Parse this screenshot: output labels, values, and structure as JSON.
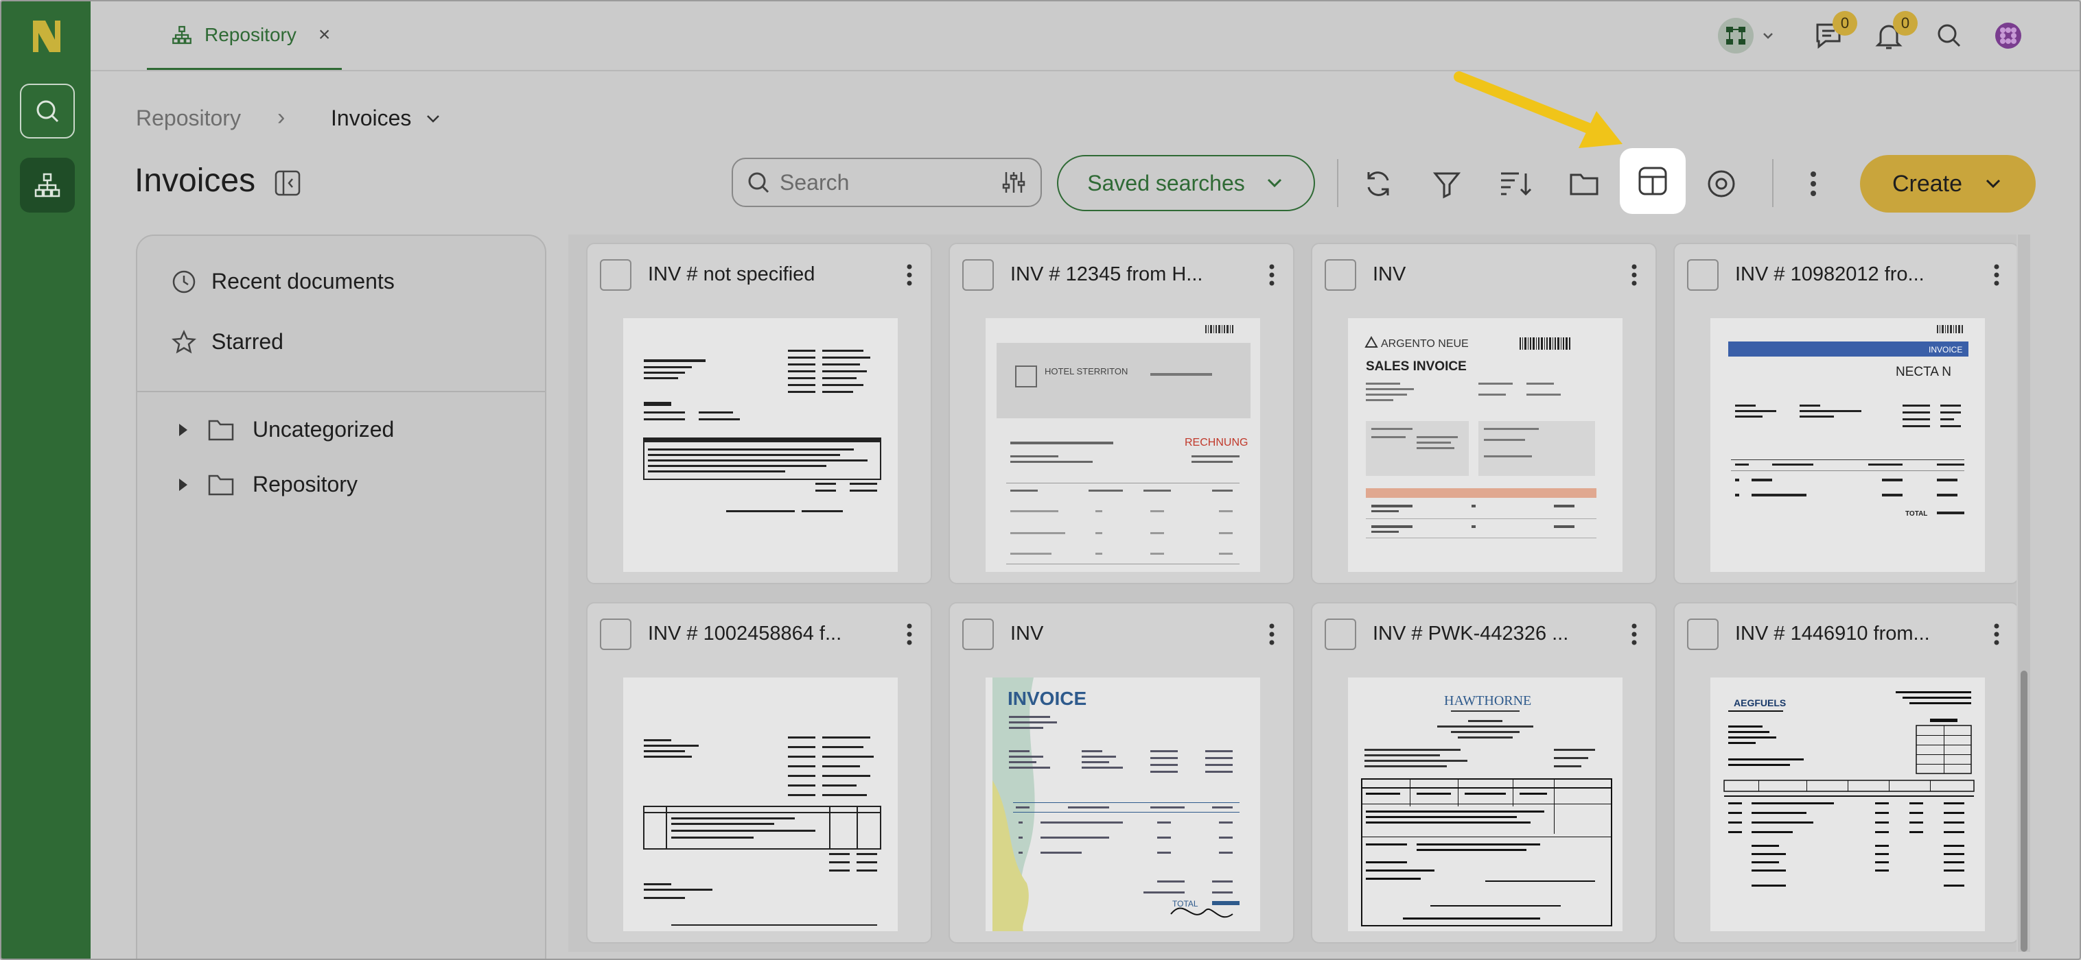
{
  "app": {
    "tab_label": "Repository",
    "tab_close": "×"
  },
  "top_badges": {
    "messages": "0",
    "notifications": "0"
  },
  "breadcrumb": {
    "root": "Repository",
    "separator": "›",
    "current": "Invoices"
  },
  "page": {
    "title": "Invoices"
  },
  "search": {
    "placeholder": "Search"
  },
  "toolbar": {
    "saved_searches": "Saved searches",
    "create": "Create"
  },
  "sidebar": {
    "nav": [
      {
        "label": "Recent documents",
        "icon": "clock-icon"
      },
      {
        "label": "Starred",
        "icon": "star-icon"
      }
    ],
    "tree": [
      {
        "label": "Uncategorized",
        "icon": "folder-icon"
      },
      {
        "label": "Repository",
        "icon": "folder-icon"
      }
    ]
  },
  "documents": [
    {
      "title": "INV # not specified"
    },
    {
      "title": "INV # 12345 from H..."
    },
    {
      "title": "INV"
    },
    {
      "title": "INV # 10982012 fro..."
    },
    {
      "title": "INV # 1002458864 f..."
    },
    {
      "title": "INV"
    },
    {
      "title": "INV # PWK-442326 ..."
    },
    {
      "title": "INV # 1446910 from..."
    }
  ],
  "thumbnails": {
    "hotel": "HOTEL STERRITON",
    "rechnung": "RECHNUNG",
    "argento": "ARGENTO NEUE",
    "sales_invoice": "SALES INVOICE",
    "invoice_label": "INVOICE",
    "nectain": "NECTA N",
    "hawthorne": "HAWTHORNE",
    "aegfuels": "AEGFUELS",
    "total": "TOTAL"
  },
  "colors": {
    "brand_green": "#2f6a35",
    "accent_gold": "#c9a53c",
    "annotation_arrow": "#f0c419"
  }
}
